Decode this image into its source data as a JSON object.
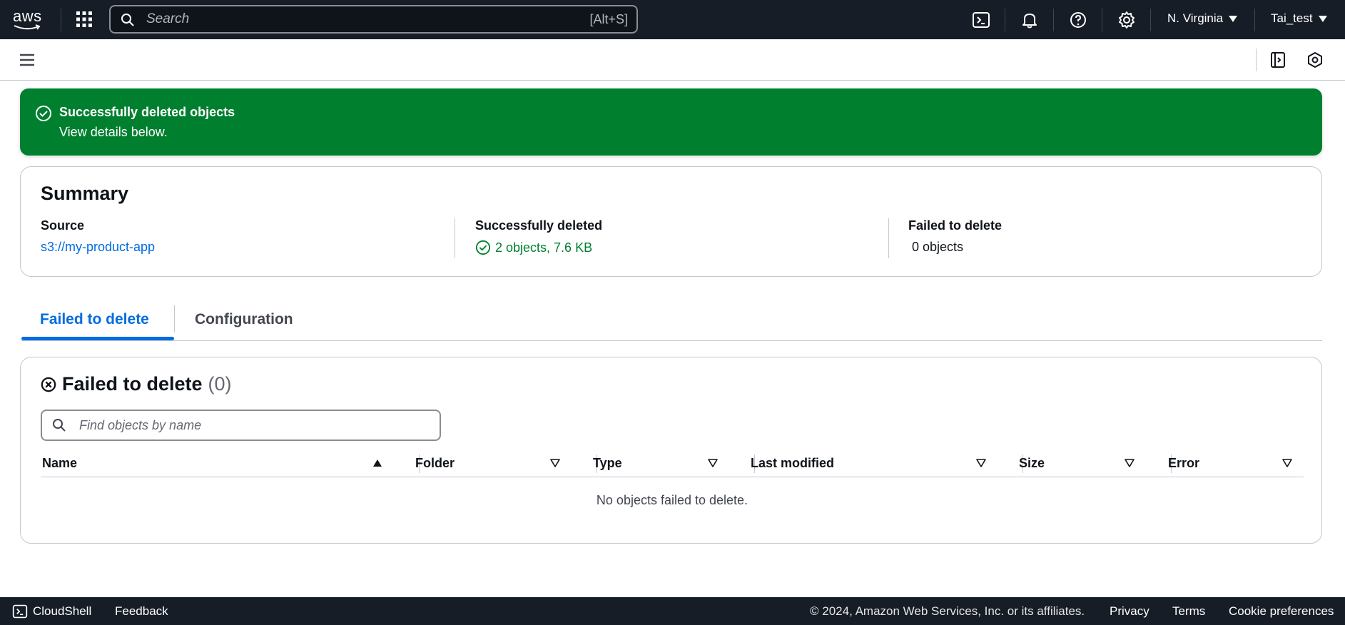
{
  "topnav": {
    "logo_text": "aws",
    "search_placeholder": "Search",
    "search_shortcut": "[Alt+S]",
    "region": "N. Virginia",
    "user": "Tai_test",
    "icons": [
      "cloudshell-icon",
      "bell-icon",
      "help-icon",
      "gear-icon"
    ]
  },
  "flash": {
    "title": "Successfully deleted objects",
    "subtitle": "View details below.",
    "color": "#00802f"
  },
  "summary": {
    "title": "Summary",
    "source_label": "Source",
    "source_value": "s3://my-product-app",
    "deleted_label": "Successfully deleted",
    "deleted_value": "2 objects, 7.6 KB",
    "failed_label": "Failed to delete",
    "failed_value": "0 objects"
  },
  "tabs": [
    {
      "label": "Failed to delete",
      "active": true
    },
    {
      "label": "Configuration",
      "active": false
    }
  ],
  "failed_section": {
    "title": "Failed to delete",
    "count": "(0)",
    "filter_placeholder": "Find objects by name",
    "columns": [
      "Name",
      "Folder",
      "Type",
      "Last modified",
      "Size",
      "Error"
    ],
    "empty_message": "No objects failed to delete."
  },
  "footer": {
    "cloudshell": "CloudShell",
    "feedback": "Feedback",
    "copyright": "© 2024, Amazon Web Services, Inc. or its affiliates.",
    "privacy": "Privacy",
    "terms": "Terms",
    "cookie": "Cookie preferences"
  },
  "colors": {
    "nav_bg": "#161d26",
    "link": "#006ce0",
    "success": "#00802f"
  }
}
